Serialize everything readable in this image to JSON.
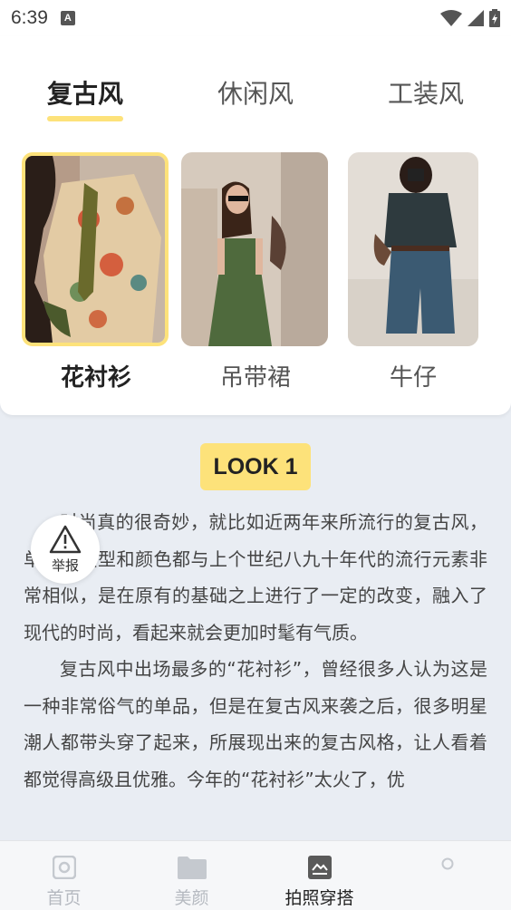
{
  "status_bar": {
    "time": "6:39",
    "notification_icon": "A",
    "icons": [
      "wifi-icon",
      "signal-icon",
      "battery-icon"
    ]
  },
  "tabs": [
    {
      "label": "复古风",
      "active": true
    },
    {
      "label": "休闲风",
      "active": false
    },
    {
      "label": "工装风",
      "active": false
    }
  ],
  "items": [
    {
      "label": "花衬衫",
      "selected": true
    },
    {
      "label": "吊带裙",
      "selected": false
    },
    {
      "label": "牛仔",
      "selected": false
    }
  ],
  "look": {
    "badge": "LOOK 1"
  },
  "article": {
    "paragraphs": [
      "时尚真的很奇妙，就比如近两年来所流行的复古风，单品的版型和颜色都与上个世纪八九十年代的流行元素非常相似，是在原有的基础之上进行了一定的改变，融入了现代的时尚，看起来就会更加时髦有气质。",
      "复古风中出场最多的“花衬衫”，曾经很多人认为这是一种非常俗气的单品，但是在复古风来袭之后，很多明星潮人都带头穿了起来，所展现出来的复古风格，让人看着都觉得高级且优雅。今年的“花衬衫”太火了，优"
    ]
  },
  "report_button": {
    "label": "举报",
    "icon": "warning-icon"
  },
  "bottom_nav": [
    {
      "label": "首页",
      "icon": "camera-icon",
      "active": false
    },
    {
      "label": "美颜",
      "icon": "folder-icon",
      "active": false
    },
    {
      "label": "拍照穿搭",
      "icon": "image-icon",
      "active": true
    },
    {
      "label": "",
      "icon": "profile-icon",
      "active": false
    }
  ],
  "colors": {
    "accent_yellow": "#fde27a",
    "background": "#e9edf3",
    "active_text": "#222222",
    "inactive_text": "#b5b9c0"
  }
}
